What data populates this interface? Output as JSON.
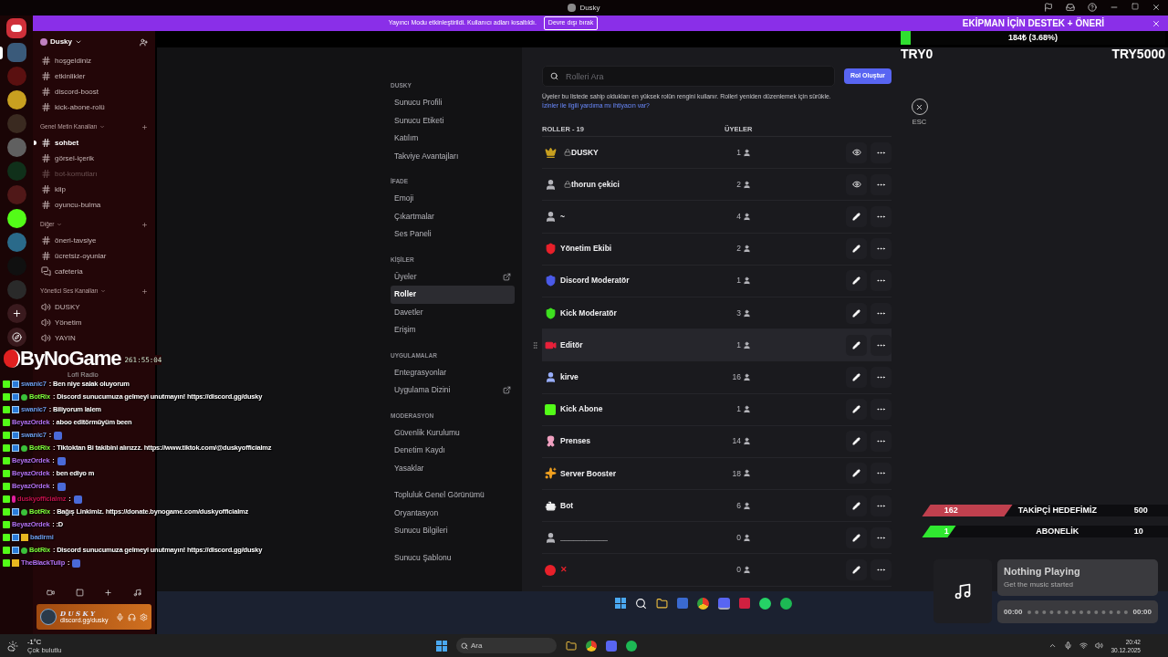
{
  "window": {
    "title": "Dusky"
  },
  "banner": {
    "text": "Yayıncı Modu etkinleştirildi. Kullanıcı adları kısaltıldı.",
    "button": "Devre dışı bırak"
  },
  "servers": [
    {
      "color": "#3a5a7a",
      "selected": true
    },
    {
      "color": "#5a1010",
      "selected": false
    },
    {
      "color": "#c8a020",
      "selected": false
    },
    {
      "color": "#3a2a20",
      "selected": false
    },
    {
      "color": "#606060",
      "selected": false
    },
    {
      "color": "#10301a",
      "selected": false
    },
    {
      "color": "#501818",
      "selected": false
    },
    {
      "color": "#53fc18",
      "selected": false
    },
    {
      "color": "#2a6a8a",
      "selected": false
    },
    {
      "color": "#101010",
      "selected": false
    },
    {
      "color": "#2a2a2a",
      "selected": false
    }
  ],
  "server_name": "Dusky",
  "channel_groups": [
    {
      "channels": [
        {
          "name": "hoşgeldiniz",
          "kind": "text",
          "unread": false,
          "muted": false
        },
        {
          "name": "etkinlikler",
          "kind": "text",
          "unread": false,
          "muted": false
        },
        {
          "name": "discord-boost",
          "kind": "text",
          "unread": false,
          "muted": false
        },
        {
          "name": "kick-abone-rolü",
          "kind": "text",
          "unread": false,
          "muted": false
        }
      ]
    },
    {
      "title": "Genel Metin Kanalları",
      "channels": [
        {
          "name": "sohbet",
          "kind": "text",
          "unread": true,
          "muted": false
        },
        {
          "name": "görsel-içerik",
          "kind": "text",
          "unread": false,
          "muted": false
        },
        {
          "name": "bot-komutları",
          "kind": "text",
          "unread": false,
          "muted": true
        },
        {
          "name": "klip",
          "kind": "text",
          "unread": false,
          "muted": false
        },
        {
          "name": "oyuncu-bulma",
          "kind": "text",
          "unread": false,
          "muted": false
        }
      ]
    },
    {
      "title": "Diğer",
      "channels": [
        {
          "name": "öneri-tavsiye",
          "kind": "text",
          "unread": false,
          "muted": false
        },
        {
          "name": "ücretsiz-oyunlar",
          "kind": "text",
          "unread": false,
          "muted": false
        },
        {
          "name": "cafeteria",
          "kind": "forum",
          "unread": false,
          "muted": false
        }
      ]
    },
    {
      "title": "Yönetici Ses Kanalları",
      "channels": [
        {
          "name": "DUSKY",
          "kind": "voice",
          "unread": false,
          "muted": false
        },
        {
          "name": "Yönetim",
          "kind": "voice",
          "unread": false,
          "muted": false
        },
        {
          "name": "YAYIN",
          "kind": "voice",
          "unread": false,
          "muted": false
        }
      ]
    }
  ],
  "user_panel": {
    "name": "D U S K Y",
    "status": "discord.gg/dusky"
  },
  "settings_nav": [
    {
      "header": "DUSKY",
      "items": [
        {
          "label": "Sunucu Profili",
          "selected": false,
          "external": false
        },
        {
          "label": "Sunucu Etiketi",
          "selected": false,
          "external": false
        },
        {
          "label": "Katılım",
          "selected": false,
          "external": false
        },
        {
          "label": "Takviye Avantajları",
          "selected": false,
          "external": false
        }
      ]
    },
    {
      "header": "İFADE",
      "items": [
        {
          "label": "Emoji",
          "selected": false,
          "external": false
        },
        {
          "label": "Çıkartmalar",
          "selected": false,
          "external": false
        },
        {
          "label": "Ses Paneli",
          "selected": false,
          "external": false
        }
      ]
    },
    {
      "header": "KİŞİLER",
      "items": [
        {
          "label": "Üyeler",
          "selected": false,
          "external": true
        },
        {
          "label": "Roller",
          "selected": true,
          "external": false
        },
        {
          "label": "Davetler",
          "selected": false,
          "external": false
        },
        {
          "label": "Erişim",
          "selected": false,
          "external": false
        }
      ]
    },
    {
      "header": "UYGULAMALAR",
      "items": [
        {
          "label": "Entegrasyonlar",
          "selected": false,
          "external": false
        },
        {
          "label": "Uygulama Dizini",
          "selected": false,
          "external": true
        }
      ]
    },
    {
      "header": "MODERASYON",
      "items": [
        {
          "label": "Güvenlik Kurulumu",
          "selected": false,
          "external": false
        },
        {
          "label": "Denetim Kaydı",
          "selected": false,
          "external": false
        },
        {
          "label": "Yasaklar",
          "selected": false,
          "external": false
        }
      ]
    },
    {
      "items": [
        {
          "label": "Topluluk Genel Görünümü",
          "selected": false,
          "external": false
        },
        {
          "label": "Oryantasyon",
          "selected": false,
          "external": false
        },
        {
          "label": "Sunucu Bilgileri",
          "selected": false,
          "external": false
        }
      ]
    },
    {
      "items": [
        {
          "label": "Sunucu Şablonu",
          "selected": false,
          "external": false
        }
      ]
    }
  ],
  "roles_page": {
    "search": {
      "placeholder": "Rolleri Ara"
    },
    "create_button": "Rol Oluştur",
    "description": "Üyeler bu listede sahip oldukları en yüksek rolün rengini kullanır. Rolleri yeniden düzenlemek için sürükle.",
    "help_link": "İzinler ile ilgili yardıma mı ihtiyacın var?",
    "columns": [
      "ROLLER - 19",
      "ÜYELER"
    ],
    "roles": [
      {
        "name": "DUSKY",
        "kind": "crown",
        "color": "#c8a020",
        "locked": true,
        "name_colored": false,
        "members": "1",
        "hovered": false
      },
      {
        "name": "thorun çekici",
        "kind": "member",
        "color": "#b5b5bb",
        "locked": true,
        "name_colored": false,
        "members": "2",
        "hovered": false
      },
      {
        "name": "~",
        "kind": "member",
        "color": "#b5b5bb",
        "locked": false,
        "name_colored": false,
        "members": "4",
        "hovered": false
      },
      {
        "name": "Yönetim Ekibi",
        "kind": "shield",
        "color": "#e8202a",
        "locked": false,
        "name_colored": false,
        "members": "2",
        "hovered": false
      },
      {
        "name": "Discord Moderatör",
        "kind": "shield",
        "color": "#4a5ae8",
        "locked": false,
        "name_colored": false,
        "members": "1",
        "hovered": false
      },
      {
        "name": "Kick Moderatör",
        "kind": "shield",
        "color": "#3ee020",
        "locked": false,
        "name_colored": false,
        "members": "3",
        "hovered": false
      },
      {
        "name": "Editör",
        "kind": "badge",
        "color": "#e8203a",
        "locked": false,
        "name_colored": false,
        "members": "1",
        "hovered": true
      },
      {
        "name": "kirve",
        "kind": "member",
        "color": "#9ab0ff",
        "locked": false,
        "name_colored": false,
        "members": "16",
        "hovered": false
      },
      {
        "name": "Kick Abone",
        "kind": "square",
        "color": "#53fc18",
        "locked": false,
        "name_colored": false,
        "members": "1",
        "hovered": false
      },
      {
        "name": "Prenses",
        "kind": "bow",
        "color": "#f0a0c0",
        "locked": false,
        "name_colored": false,
        "members": "14",
        "hovered": false
      },
      {
        "name": "Server Booster",
        "kind": "burst",
        "color": "#f0a020",
        "locked": false,
        "name_colored": false,
        "members": "18",
        "hovered": false
      },
      {
        "name": "Bot",
        "kind": "bot",
        "color": "#f0f0f0",
        "locked": false,
        "name_colored": false,
        "members": "6",
        "hovered": false
      },
      {
        "name": "___________",
        "kind": "member",
        "color": "#b5b5bb",
        "locked": false,
        "name_colored": false,
        "members": "0",
        "hovered": false
      },
      {
        "name": "✕",
        "kind": "circle",
        "color": "#e8202a",
        "locked": false,
        "name_colored": true,
        "members": "0",
        "hovered": false
      }
    ]
  },
  "close_button": {
    "label": "ESC"
  },
  "stream_overlay": {
    "logo": "ByNoGame",
    "timer": "261:55:04",
    "radio": "Lofi Radio",
    "donation": {
      "title": "EKİPMAN İÇİN DESTEK + ÖNERİ",
      "level": 0.0368,
      "reading": "184₺ (3.68%)",
      "min": "TRY0",
      "max": "TRY5000"
    },
    "goals": [
      {
        "current": "162",
        "label": "TAKİPÇİ HEDEFİMİZ",
        "target": "500",
        "level": 0.324,
        "color": "#c0404e"
      },
      {
        "current": "1",
        "label": "ABONELİK",
        "target": "10",
        "level": 0.1,
        "color": "#30e830"
      }
    ],
    "music": {
      "title": "Nothing Playing",
      "subtitle": "Get the music started",
      "elapsed": "00:00",
      "total": "00:00",
      "level": 0
    }
  },
  "chat": [
    {
      "user": "swanic7",
      "color": "#6a9ae8",
      "badges": [
        {
          "kind": "kick"
        },
        {
          "kind": "mod"
        }
      ],
      "text": ": Ben niye salak oluyorum",
      "emote": false
    },
    {
      "user": "BotRix",
      "color": "#7cfc3a",
      "badges": [
        {
          "kind": "kick"
        },
        {
          "kind": "mod"
        },
        {
          "kind": "bot"
        }
      ],
      "text": ": Discord sunucumuza gelmeyi unutmayın! https://discord.gg/dusky",
      "emote": false
    },
    {
      "user": "swanic7",
      "color": "#6a9ae8",
      "badges": [
        {
          "kind": "kick"
        },
        {
          "kind": "mod"
        }
      ],
      "text": ": Biliyorum lalem",
      "emote": false
    },
    {
      "user": "BeyazOrdek",
      "color": "#b070f0",
      "badges": [
        {
          "kind": "kick"
        }
      ],
      "text": ": aboo editörmüyüm been",
      "emote": false
    },
    {
      "user": "swanic7",
      "color": "#6a9ae8",
      "badges": [
        {
          "kind": "kick"
        },
        {
          "kind": "mod"
        }
      ],
      "text": ":",
      "emote": true
    },
    {
      "user": "BotRix",
      "color": "#7cfc3a",
      "badges": [
        {
          "kind": "kick"
        },
        {
          "kind": "mod"
        },
        {
          "kind": "bot"
        }
      ],
      "text": ": Tiktoktan Bi takibini alırızzz. https://www.tiktok.com/@duskyofficialmz",
      "emote": false
    },
    {
      "user": "BeyazOrdek",
      "color": "#b070f0",
      "badges": [
        {
          "kind": "kick"
        }
      ],
      "text": ":",
      "emote": true
    },
    {
      "user": "BeyazOrdek",
      "color": "#b070f0",
      "badges": [
        {
          "kind": "kick"
        }
      ],
      "text": ": ben ediyo m",
      "emote": false
    },
    {
      "user": "BeyazOrdek",
      "color": "#b070f0",
      "badges": [
        {
          "kind": "kick"
        }
      ],
      "text": ":",
      "emote": true
    },
    {
      "user": "duskyofficialmz",
      "color": "#c0104a",
      "badges": [
        {
          "kind": "kick"
        },
        {
          "kind": "broadcaster"
        }
      ],
      "text": ":",
      "emote": true
    },
    {
      "user": "BotRix",
      "color": "#7cfc3a",
      "badges": [
        {
          "kind": "kick"
        },
        {
          "kind": "mod"
        },
        {
          "kind": "bot"
        }
      ],
      "text": ": Bağış Linkimiz. https://donate.bynogame.com/duskyofficialmz",
      "emote": false
    },
    {
      "user": "BeyazOrdek",
      "color": "#b070f0",
      "badges": [
        {
          "kind": "kick"
        }
      ],
      "text": ": :D",
      "emote": false
    },
    {
      "user": "badirmi",
      "color": "#6a9ae8",
      "badges": [
        {
          "kind": "kick"
        },
        {
          "kind": "mod"
        },
        {
          "kind": "vip"
        }
      ],
      "emote": false
    },
    {
      "user": "BotRix",
      "color": "#7cfc3a",
      "badges": [
        {
          "kind": "kick"
        },
        {
          "kind": "mod"
        },
        {
          "kind": "bot"
        }
      ],
      "text": ": Discord sunucumuza gelmeyi unutmayın! https://discord.gg/dusky",
      "emote": false
    },
    {
      "user": "TheBlackTulip",
      "color": "#b070f0",
      "badges": [
        {
          "kind": "kick"
        },
        {
          "kind": "vip"
        }
      ],
      "text": ":",
      "emote": true
    }
  ],
  "taskbar": {
    "weather": {
      "temperature": "-1°C",
      "condition": "Çok bulutlu"
    },
    "search": {
      "placeholder": "Ara"
    },
    "time": "20:42",
    "date": "30.12.2025"
  }
}
